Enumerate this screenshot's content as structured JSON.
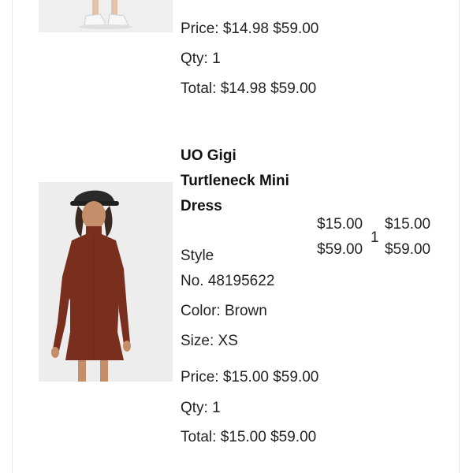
{
  "item1": {
    "price_line": "Price: $14.98 $59.00",
    "qty_line": "Qty: 1",
    "total_line": "Total: $14.98 $59.00"
  },
  "item2": {
    "title_lines": [
      "UO Gigi",
      "Turtleneck Mini",
      "Dress"
    ],
    "price_col": {
      "line1": "$15.00",
      "line2": "$59.00"
    },
    "qty": "1",
    "total_col": {
      "line1": "$15.00",
      "line2": "$59.00"
    },
    "style_line1": "Style",
    "style_line2": "No. 48195622",
    "color_line": "Color: Brown",
    "size_line": "Size: XS",
    "price_line": "Price: $15.00 $59.00",
    "qty_line": "Qty: 1",
    "total_line": "Total: $15.00 $59.00"
  },
  "colors": {
    "dress": "#7a2f1e",
    "hat": "#2a2a2a",
    "background_image": "#ededed"
  }
}
